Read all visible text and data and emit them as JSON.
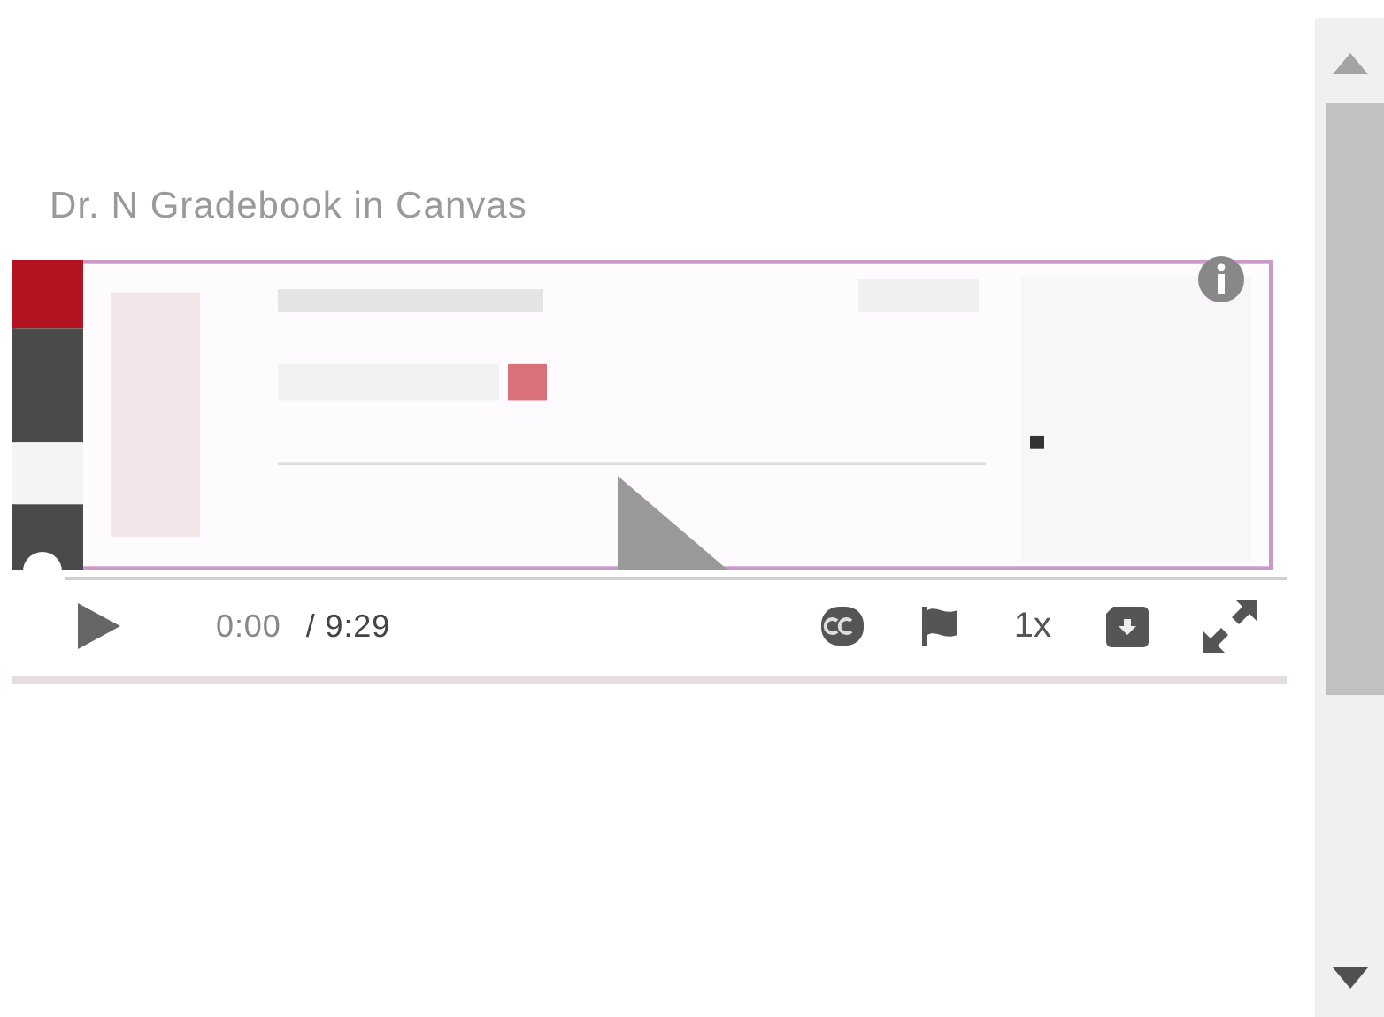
{
  "title": "Dr. N Gradebook in Canvas",
  "player": {
    "current_time": "0:00",
    "duration": "/ 9:29",
    "speed": "1x"
  }
}
